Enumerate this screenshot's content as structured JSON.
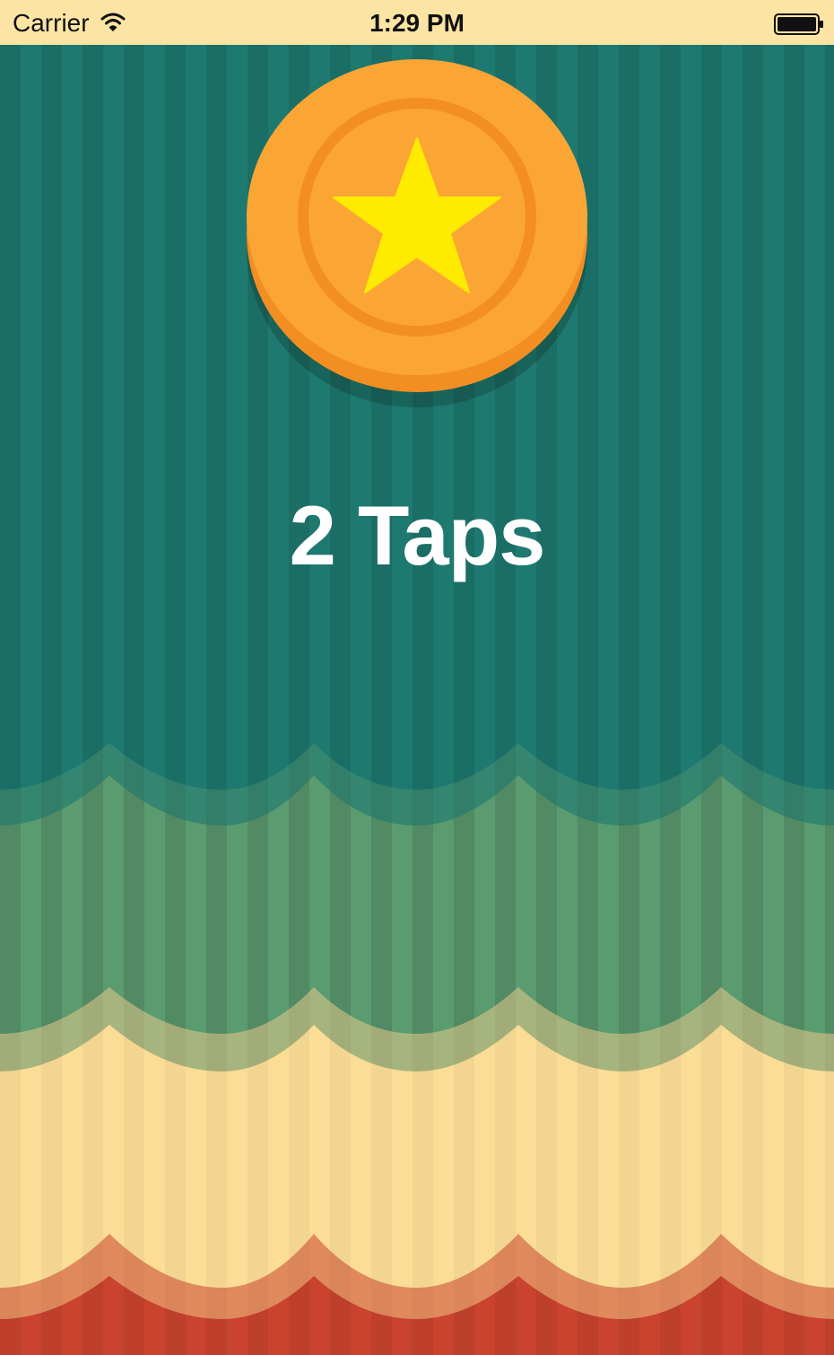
{
  "status_bar": {
    "carrier": "Carrier",
    "time": "1:29 PM",
    "wifi_icon": "wifi-icon",
    "battery_icon": "battery-icon"
  },
  "game": {
    "tap_count_label": "2 Taps",
    "coin_icon": "star-coin-icon"
  },
  "colors": {
    "background_top": "#1e7a70",
    "stripe_dark": "#1f6e55",
    "wave_green": "#5e9d6f",
    "wave_yellow": "#fbdd95",
    "wave_red": "#c9432f",
    "coin_orange": "#fba535",
    "coin_rim": "#f38e23",
    "star_yellow": "#ffeb00",
    "status_bar_bg": "#fce5a4"
  }
}
